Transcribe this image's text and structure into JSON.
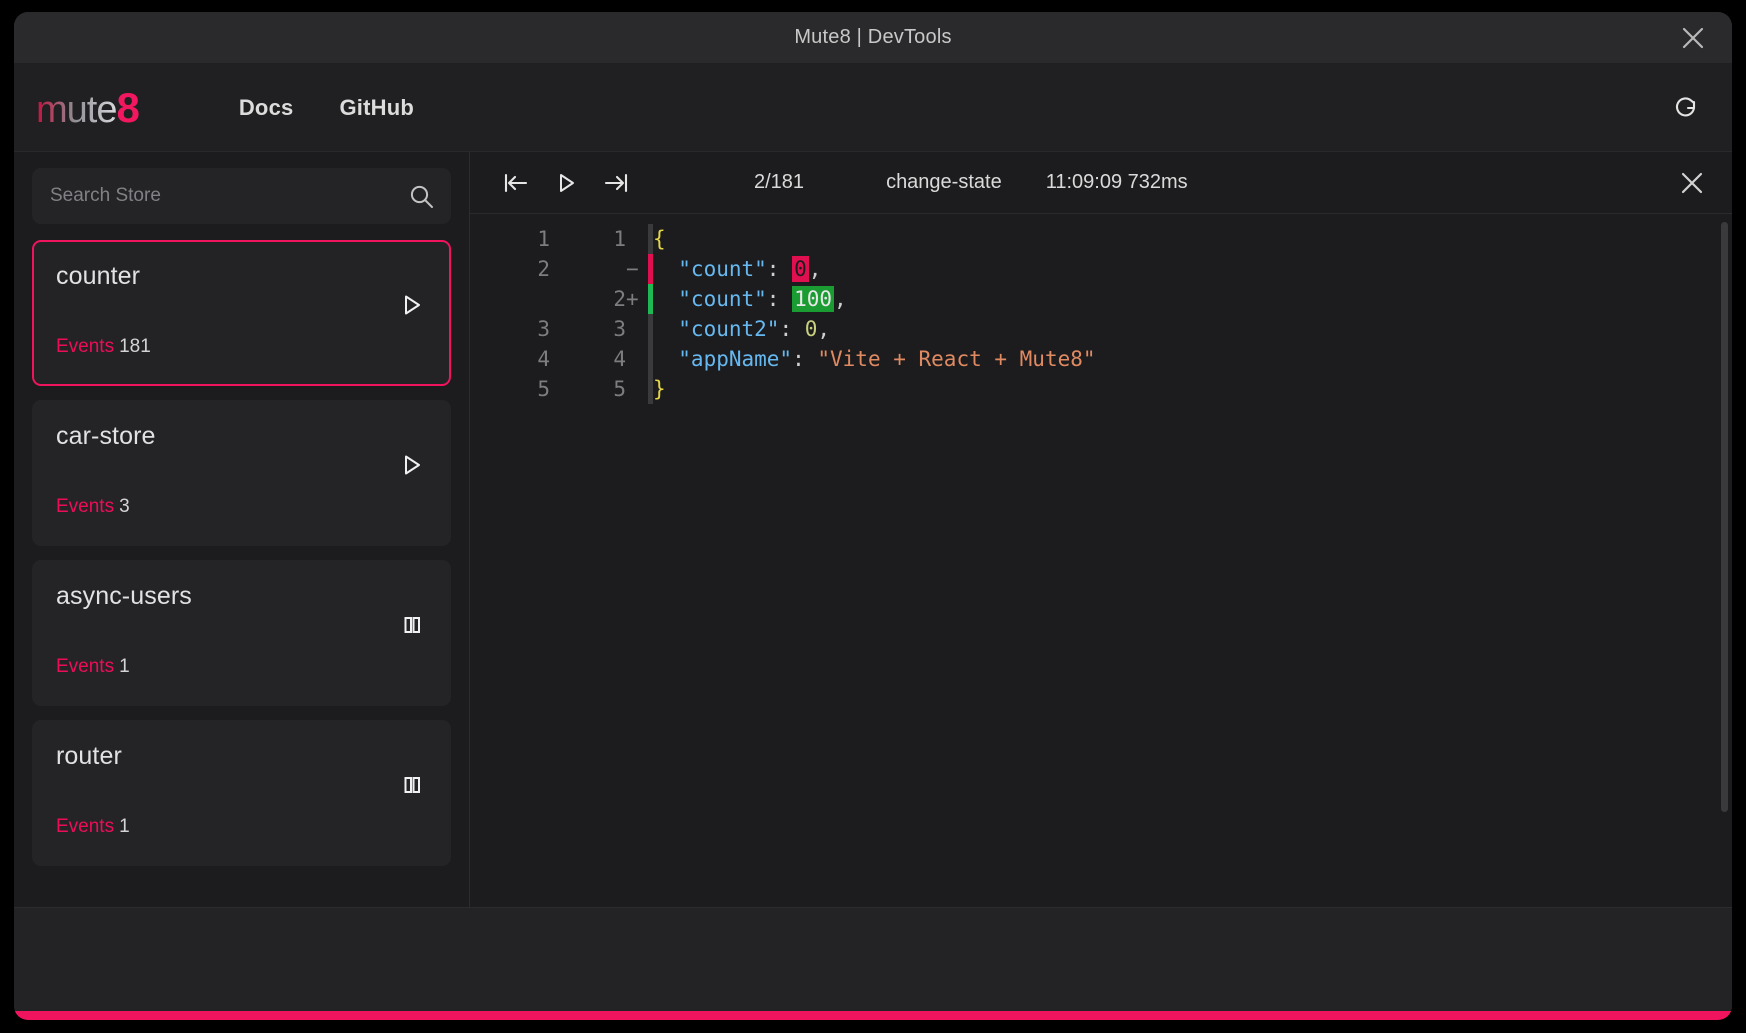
{
  "window": {
    "title": "Mute8 | DevTools",
    "close_icon": "close-icon"
  },
  "nav": {
    "logo_main": "mute",
    "logo_accent": "8",
    "links": [
      {
        "label": "Docs"
      },
      {
        "label": "GitHub"
      }
    ],
    "refresh_icon": "refresh-icon"
  },
  "sidebar": {
    "search": {
      "placeholder": "Search Store",
      "value": "",
      "icon": "search-icon"
    },
    "events_label": "Events",
    "stores": [
      {
        "name": "counter",
        "events": "181",
        "state": "playing",
        "toggle_icon": "play-icon",
        "selected": true
      },
      {
        "name": "car-store",
        "events": "3",
        "state": "playing",
        "toggle_icon": "play-icon",
        "selected": false
      },
      {
        "name": "async-users",
        "events": "1",
        "state": "paused",
        "toggle_icon": "pause-icon",
        "selected": false
      },
      {
        "name": "router",
        "events": "1",
        "state": "paused",
        "toggle_icon": "pause-icon",
        "selected": false
      }
    ]
  },
  "detail": {
    "toolbar": {
      "skip_back_icon": "skip-back-icon",
      "play_icon": "play-icon",
      "skip_forward_icon": "skip-forward-icon",
      "counter": "2/181",
      "action": "change-state",
      "timestamp": "11:09:09 732ms",
      "close_icon": "close-icon"
    },
    "diff": {
      "lines": [
        {
          "old_no": "1",
          "new_no": "1",
          "marker": "",
          "kind": "context",
          "tokens": [
            {
              "t": "punc",
              "v": "{"
            }
          ]
        },
        {
          "old_no": "2",
          "new_no": "",
          "marker": "−",
          "kind": "del",
          "tokens": [
            {
              "t": "key",
              "v": "  \"count\""
            },
            {
              "t": "colon",
              "v": ": "
            },
            {
              "t": "hl-del",
              "v": "0"
            },
            {
              "t": "comma",
              "v": ","
            }
          ]
        },
        {
          "old_no": "",
          "new_no": "2",
          "marker": "+",
          "kind": "add",
          "tokens": [
            {
              "t": "key",
              "v": "  \"count\""
            },
            {
              "t": "colon",
              "v": ": "
            },
            {
              "t": "hl-add",
              "v": "100"
            },
            {
              "t": "comma",
              "v": ","
            }
          ]
        },
        {
          "old_no": "3",
          "new_no": "3",
          "marker": "",
          "kind": "context",
          "tokens": [
            {
              "t": "key",
              "v": "  \"count2\""
            },
            {
              "t": "colon",
              "v": ": "
            },
            {
              "t": "num",
              "v": "0"
            },
            {
              "t": "comma",
              "v": ","
            }
          ]
        },
        {
          "old_no": "4",
          "new_no": "4",
          "marker": "",
          "kind": "context",
          "tokens": [
            {
              "t": "key",
              "v": "  \"appName\""
            },
            {
              "t": "colon",
              "v": ": "
            },
            {
              "t": "str",
              "v": "\"Vite + React + Mute8\""
            }
          ]
        },
        {
          "old_no": "5",
          "new_no": "5",
          "marker": "",
          "kind": "context",
          "tokens": [
            {
              "t": "punc",
              "v": "}"
            }
          ]
        }
      ]
    }
  },
  "theme": {
    "accent": "#f0135e",
    "accent_text": "#ed0d57",
    "bg": "#1c1c1e",
    "panel": "#242427",
    "diff_add": "#1a9c32",
    "diff_del": "#e01050"
  }
}
